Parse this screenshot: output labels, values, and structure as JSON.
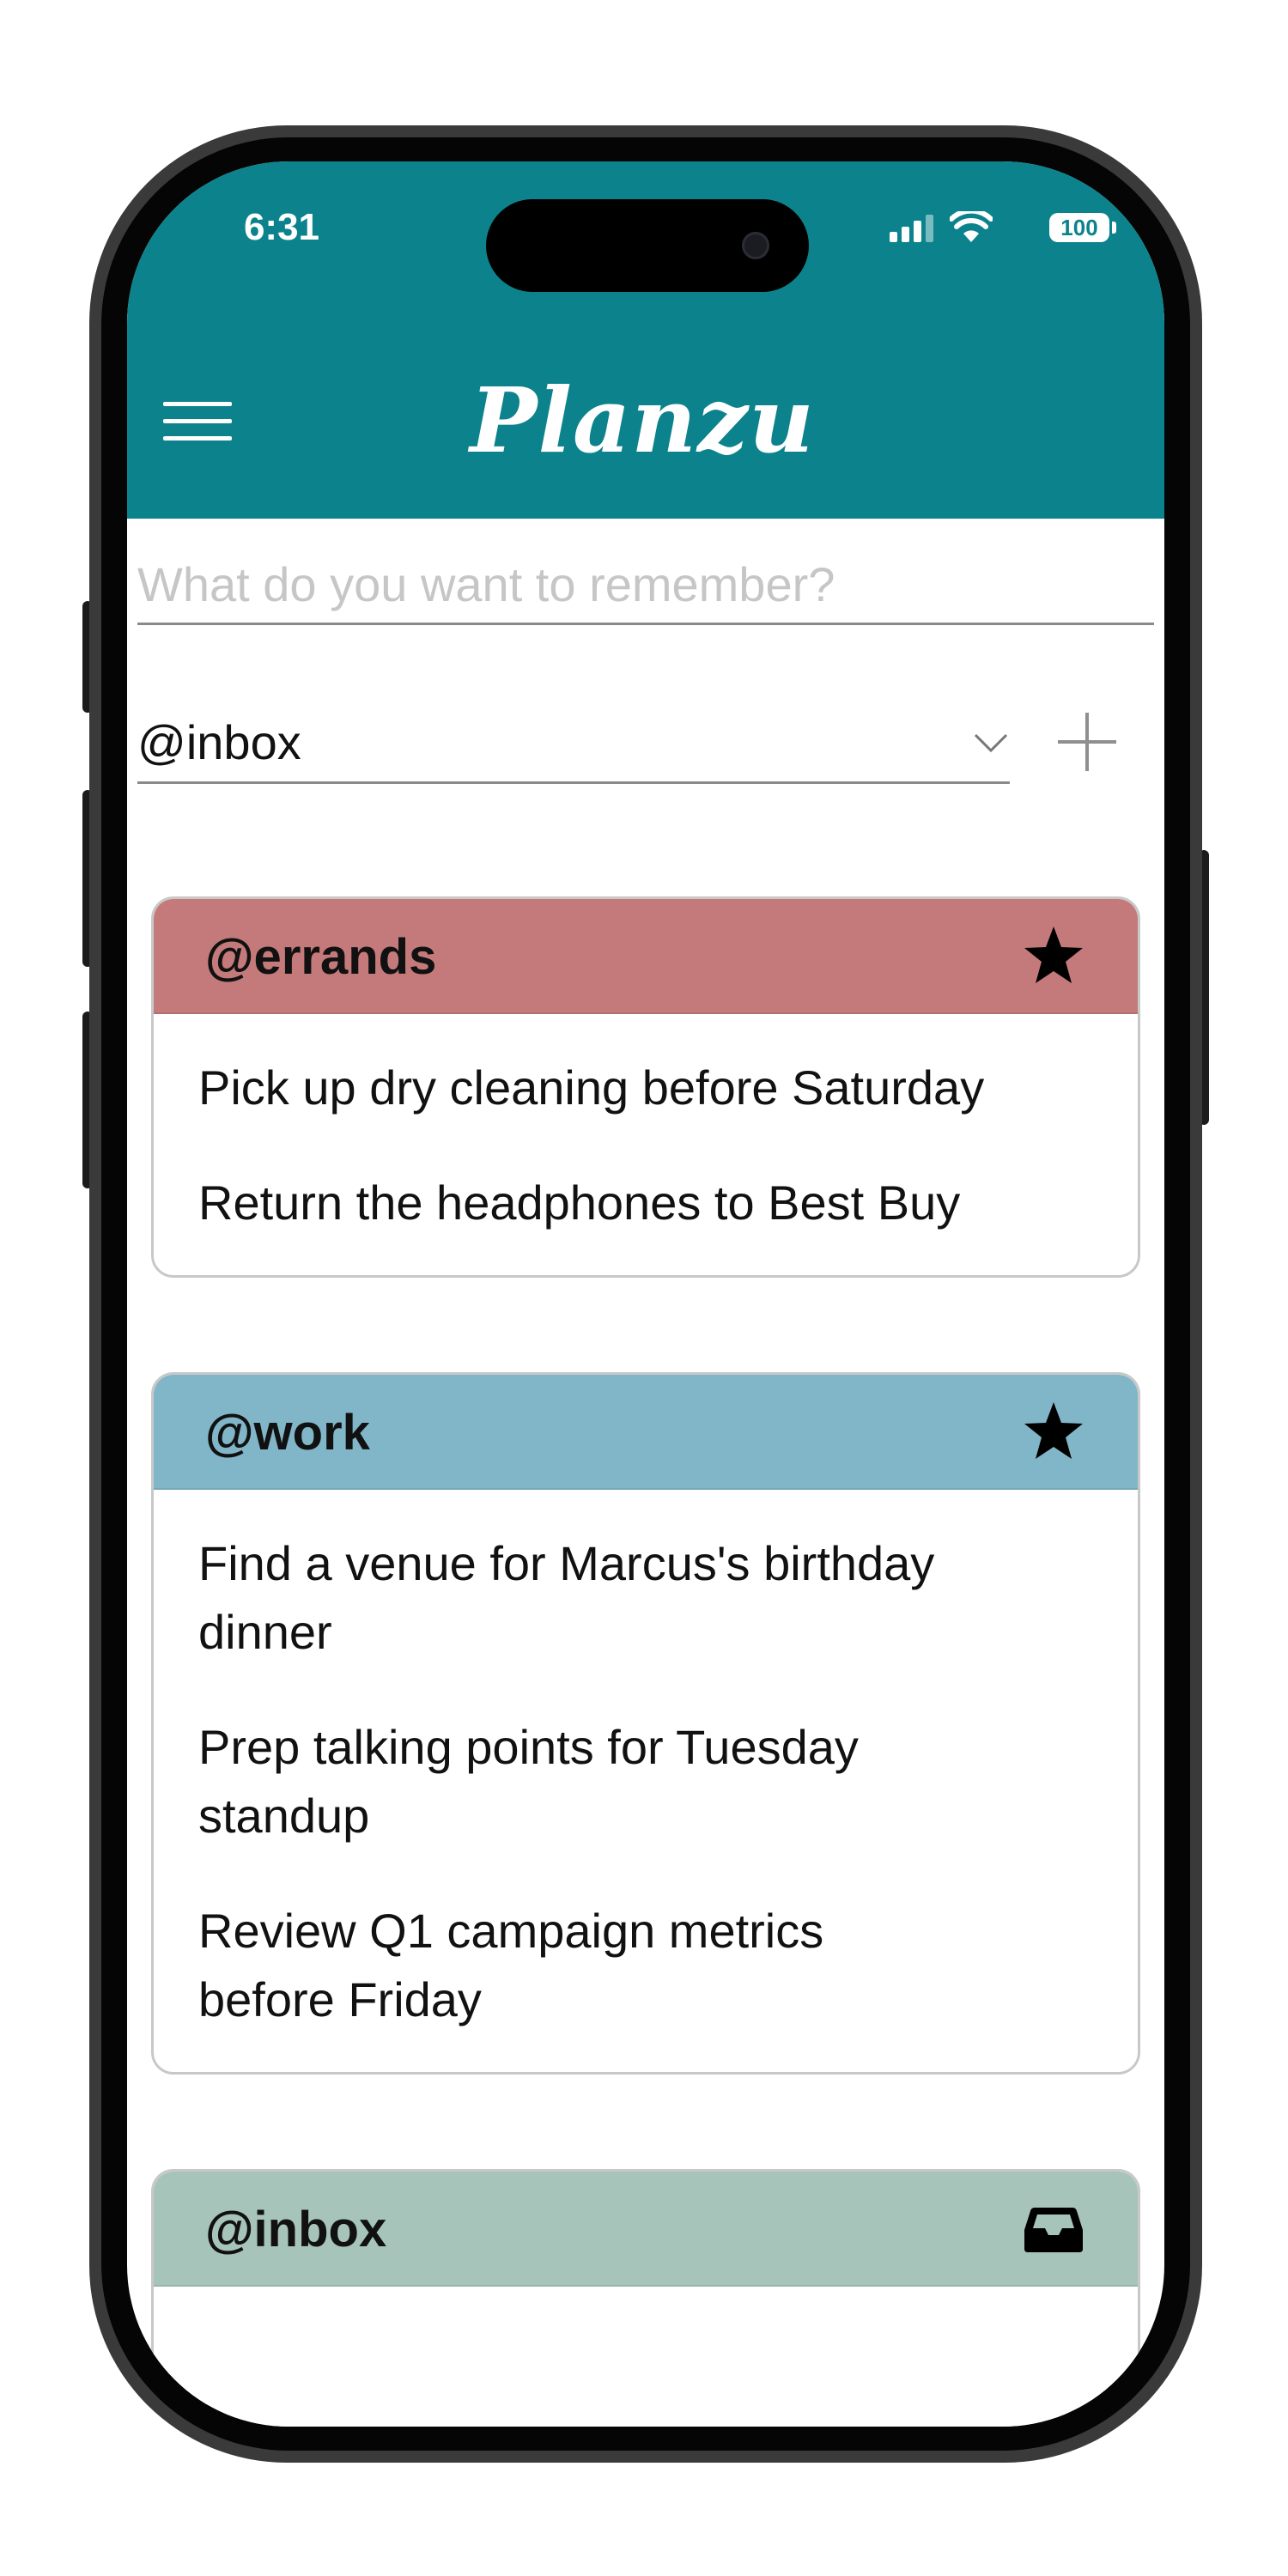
{
  "status_bar": {
    "time": "6:31",
    "battery": "100"
  },
  "header": {
    "logo": "Planzu",
    "background_color": "#0c838c"
  },
  "composer": {
    "placeholder": "What do you want to remember?",
    "list_select_value": "@inbox",
    "add_icon": "plus-icon"
  },
  "lists": [
    {
      "name": "@errands",
      "header_color": "#c47a7a",
      "icon": "star-icon",
      "tasks": [
        "Pick up dry cleaning before Saturday",
        "Return the headphones to Best Buy"
      ]
    },
    {
      "name": "@work",
      "header_color": "#80b6c8",
      "icon": "star-icon",
      "tasks": [
        "Find a venue for Marcus's birthday dinner",
        "Prep talking points for Tuesday standup",
        "Review Q1 campaign metrics before Friday"
      ]
    },
    {
      "name": "@inbox",
      "header_color": "#a7c4bb",
      "icon": "inbox-tray-icon",
      "tasks": []
    }
  ]
}
